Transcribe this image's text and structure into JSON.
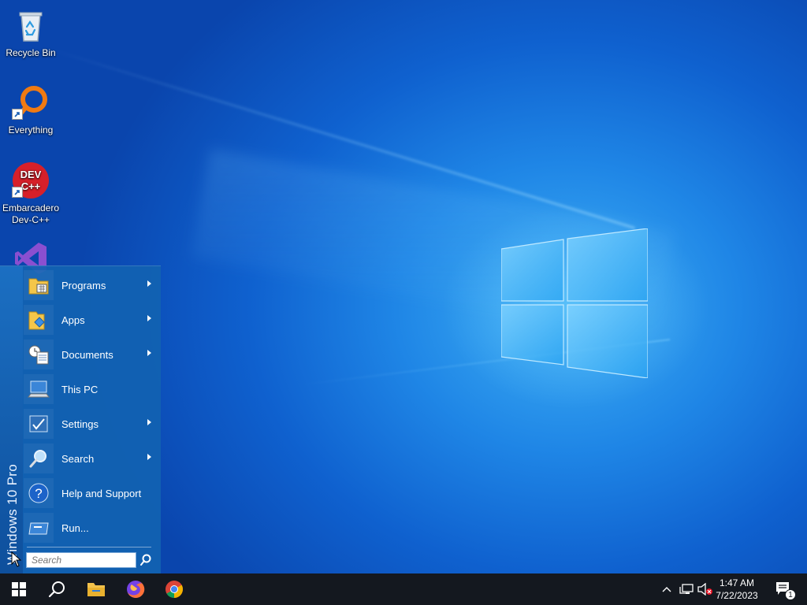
{
  "desktop": {
    "icons": [
      {
        "label": "Recycle Bin"
      },
      {
        "label": "Everything"
      },
      {
        "label": "Embarcadero Dev-C++"
      },
      {
        "label": "Visual Studio"
      }
    ],
    "devcpp_logo_text": "DEV C++"
  },
  "start_menu": {
    "banner": "Windows 10 Pro",
    "items": [
      {
        "label": "Programs",
        "icon": "programs-folder-icon",
        "submenu": true
      },
      {
        "label": "Apps",
        "icon": "apps-folder-icon",
        "submenu": true
      },
      {
        "label": "Documents",
        "icon": "documents-icon",
        "submenu": true
      },
      {
        "label": "This PC",
        "icon": "computer-icon",
        "submenu": false
      },
      {
        "label": "Settings",
        "icon": "settings-icon",
        "submenu": true
      },
      {
        "label": "Search",
        "icon": "magnifier-icon",
        "submenu": true
      },
      {
        "label": "Help and Support",
        "icon": "help-icon",
        "submenu": false
      },
      {
        "label": "Run...",
        "icon": "run-icon",
        "submenu": false
      }
    ],
    "search_placeholder": "Search"
  },
  "taskbar": {
    "buttons": [
      "start",
      "search",
      "file-explorer",
      "firefox",
      "chrome"
    ],
    "clock": {
      "time": "1:47 AM",
      "date": "7/22/2023"
    },
    "notification_count": "1"
  },
  "colors": {
    "accent": "#1262b2",
    "taskbar": "#14181f"
  }
}
